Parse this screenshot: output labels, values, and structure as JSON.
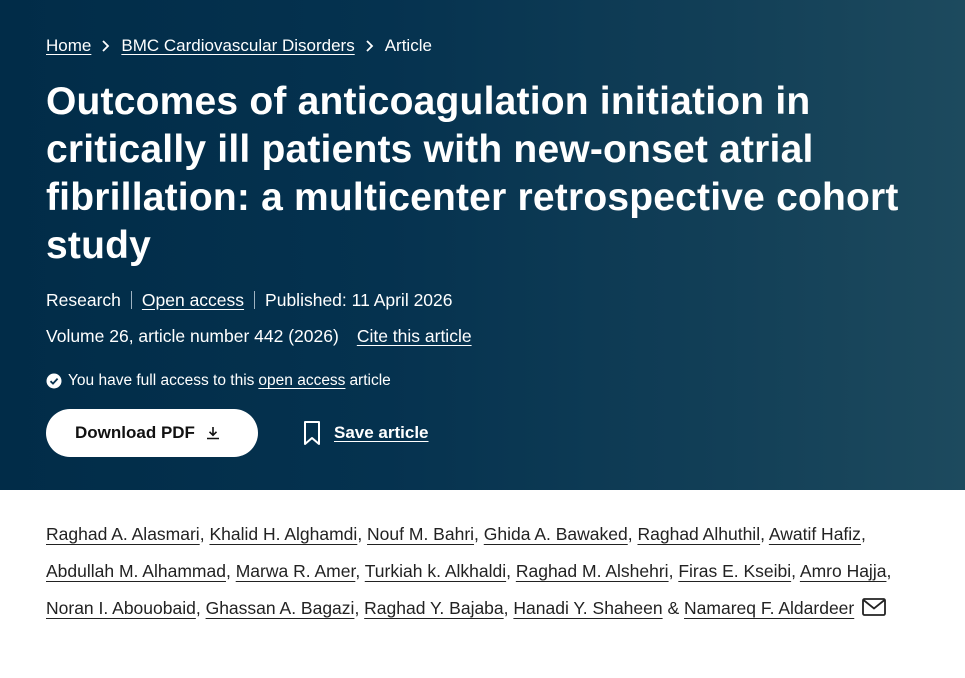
{
  "breadcrumb": {
    "home": "Home",
    "journal": "BMC Cardiovascular Disorders",
    "current": "Article"
  },
  "article": {
    "title": "Outcomes of anticoagulation initiation in critically ill patients with new-onset atrial fibrillation: a multicenter retrospective cohort study",
    "type": "Research",
    "open_access": "Open access",
    "published": "Published: 11 April 2026",
    "volume": "Volume 26, article number 442 (2026)",
    "cite": "Cite this article"
  },
  "access": {
    "prefix": "You have full access to this",
    "link": "open access",
    "suffix": "article"
  },
  "actions": {
    "download_pdf": "Download PDF",
    "save_article": "Save article"
  },
  "authors": [
    "Raghad A. Alasmari",
    "Khalid H. Alghamdi",
    "Nouf M. Bahri",
    "Ghida A. Bawaked",
    "Raghad Alhuthil",
    "Awatif Hafiz",
    "Abdullah M. Alhammad",
    "Marwa R. Amer",
    "Turkiah k. Alkhaldi",
    "Raghad M. Alshehri",
    "Firas E. Kseibi",
    "Amro Hajja",
    "Noran I. Abouobaid",
    "Ghassan A. Bagazi",
    "Raghad Y. Bajaba",
    "Hanadi Y. Shaheen",
    "Namareq F. Aldardeer"
  ],
  "author_separator": ", ",
  "author_last_separator": " & ",
  "icons": {
    "chevron": "chevron-right-icon",
    "check": "check-circle-icon",
    "download": "download-icon",
    "bookmark": "bookmark-icon",
    "mail": "mail-icon"
  },
  "colors": {
    "hero_dark": "#012c48",
    "hero_light": "#1d4a5e",
    "button_bg": "#ffffff"
  }
}
